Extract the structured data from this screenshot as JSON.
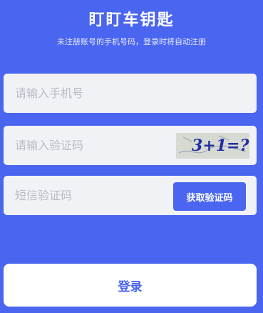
{
  "header": {
    "title": "盯盯车钥匙",
    "subtitle": "未注册账号的手机号码，登录时将自动注册"
  },
  "form": {
    "phone_placeholder": "请输入手机号",
    "captcha_placeholder": "请输入验证码",
    "captcha_image_text": "3+1=?",
    "sms_placeholder": "短信验证码",
    "sms_button_label": "获取验证码",
    "login_button_label": "登录"
  },
  "colors": {
    "primary": "#4a65f0",
    "field_bg": "#f1f2f6",
    "placeholder": "#b9bcc6",
    "captcha_text": "#1f2fa0"
  }
}
